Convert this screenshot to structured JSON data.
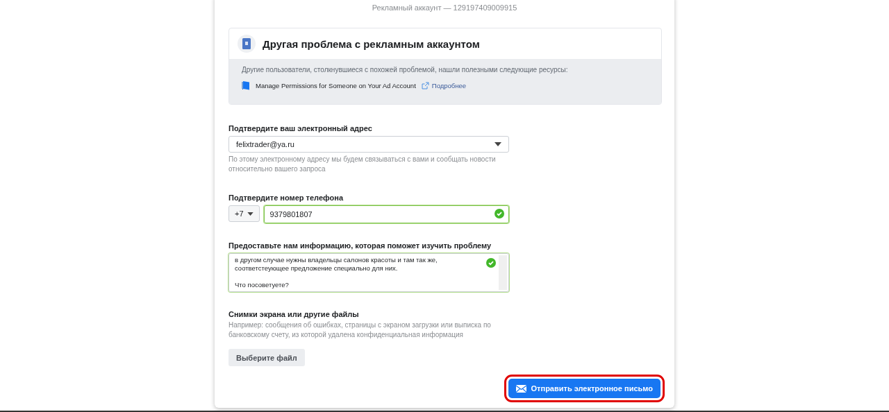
{
  "account_line": "Рекламный аккаунт — 129197409009915",
  "problem": {
    "title": "Другая проблема с рекламным аккаунтом",
    "intro": "Другие пользователи, столкнувшиеся с похожей проблемой, нашли полезными следующие ресурсы:",
    "resources": [
      {
        "title": "Manage Permissions for Someone on Your Ad Account",
        "link": "Подробнее"
      }
    ]
  },
  "email": {
    "label": "Подтвердите ваш электронный адрес",
    "value": "felixtrader@ya.ru",
    "help": "По этому электронному адресу мы будем связываться с вами и сообщать новости относительно вашего запроса"
  },
  "phone": {
    "label": "Подтвердите номер телефона",
    "country_code": "+7",
    "value": "9379801807",
    "valid": true
  },
  "details": {
    "label": "Предоставьте нам информацию, которая поможет изучить проблему",
    "value": "в другом случае нужны владельцы салонов красоты и там так же,\nсоответстеующее предложение специально для них.\n\nЧто посоветуете?",
    "valid": true
  },
  "files": {
    "label": "Снимки экрана или другие файлы",
    "help": "Например: сообщения об ошибках, страницы с экраном загрузки или выписка по банковскому счету, из которой удалена конфиденциальная информация",
    "button": "Выберите файл"
  },
  "send_button": {
    "label": "Отправить электронное письмо",
    "highlighted": true
  }
}
